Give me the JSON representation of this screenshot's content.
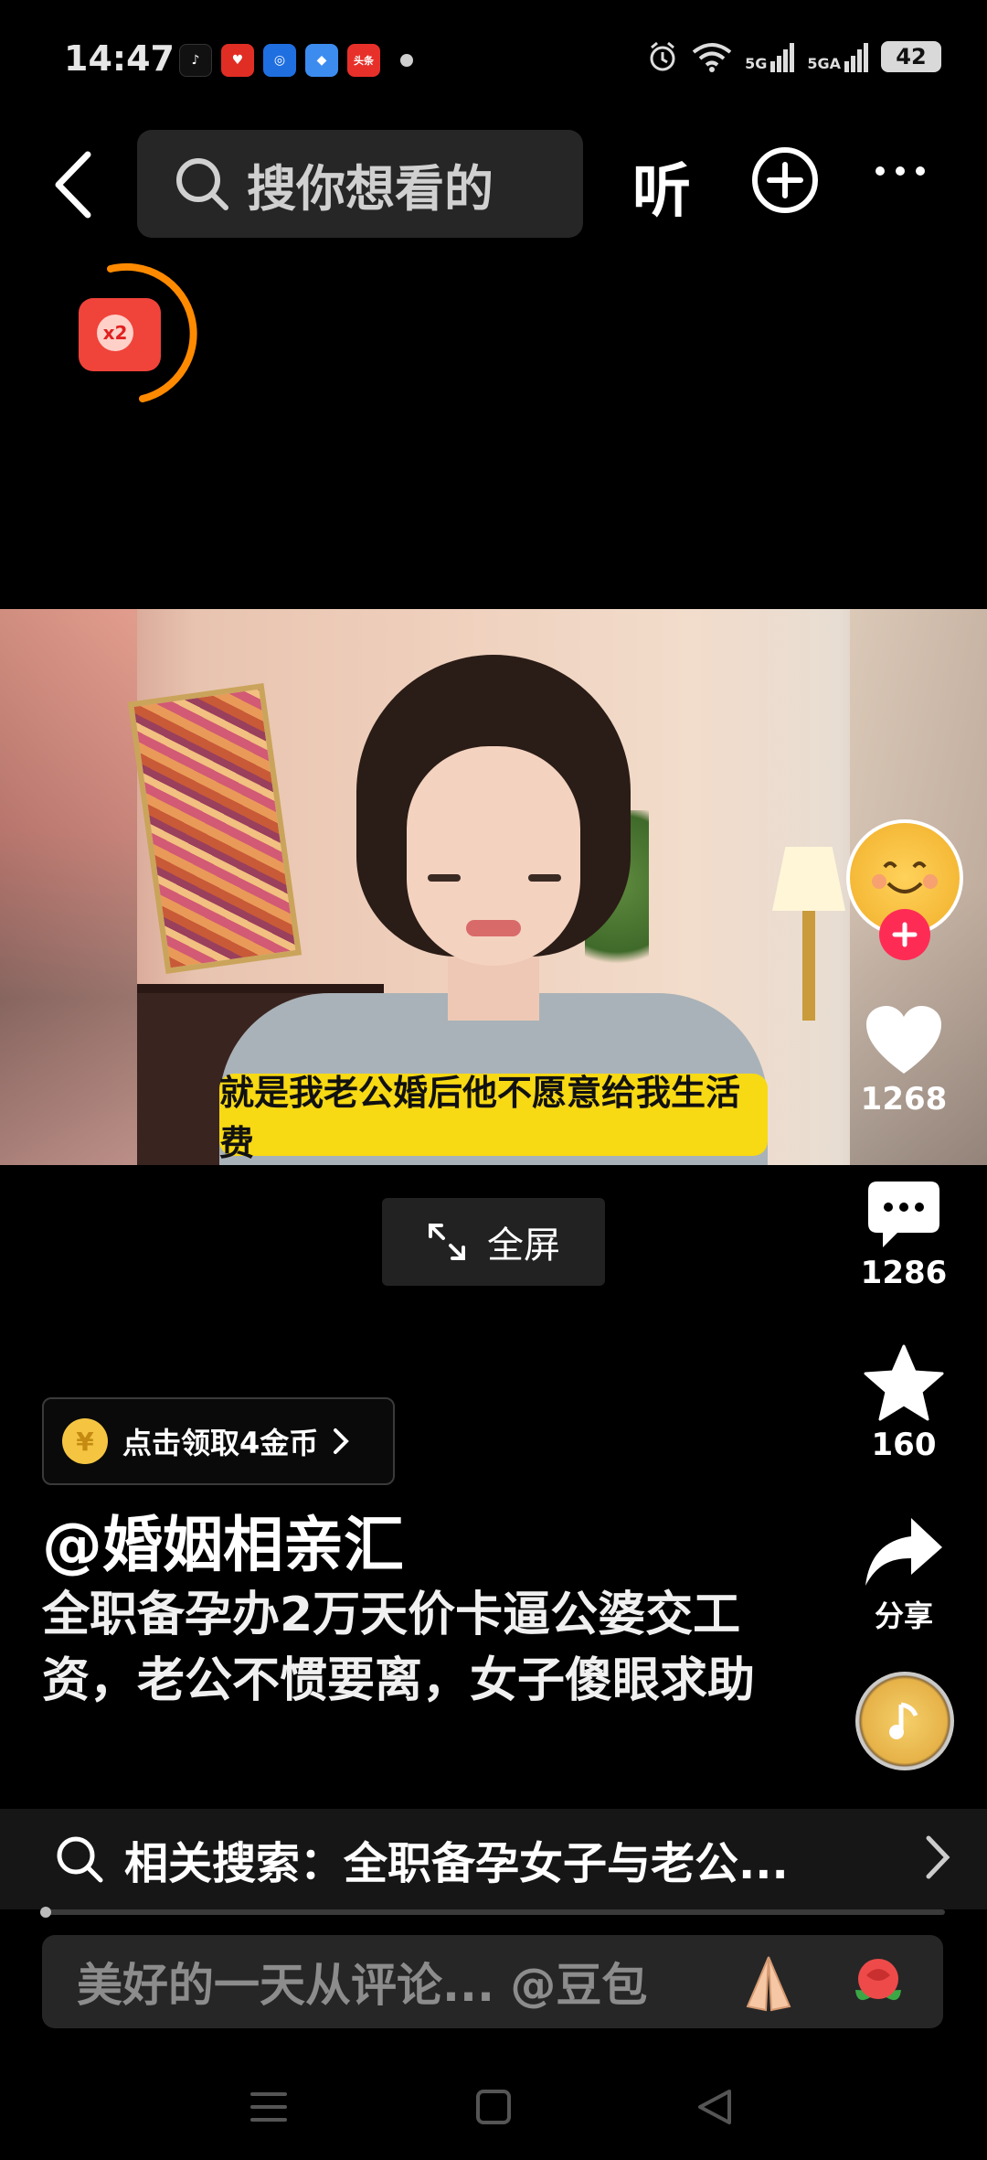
{
  "status_bar": {
    "time": "14:47",
    "notification_icons": [
      {
        "name": "tiktok-icon",
        "color": "#111111",
        "glyph": "♪"
      },
      {
        "name": "pinduoduo-icon",
        "color": "#e02e24",
        "glyph": "♥"
      },
      {
        "name": "app-blue-icon",
        "color": "#1f6fe0",
        "glyph": "◎"
      },
      {
        "name": "app-blue2-icon",
        "color": "#3c8cf0",
        "glyph": "◆"
      },
      {
        "name": "toutiao-icon",
        "color": "#e8302a",
        "glyph": "头条"
      }
    ],
    "sig1": "5G",
    "sig2": "5GA",
    "battery": "42"
  },
  "nav": {
    "search_placeholder": "搜你想看的",
    "listen_label": "听"
  },
  "red_packet": {
    "multiplier": "x2"
  },
  "video": {
    "subtitle": "就是我老公婚后他不愿意给我生活费",
    "fullscreen_label": "全屏"
  },
  "rail": {
    "likes": "1268",
    "comments": "1286",
    "favorites": "160",
    "share_label": "分享"
  },
  "info": {
    "coin_label": "点击领取4金币",
    "author": "@婚姻相亲汇",
    "description": "全职备孕办2万天价卡逼公婆交工资，老公不惯要离，女子傻眼求助"
  },
  "related": {
    "label": "相关搜索：全职备孕女子与老公..."
  },
  "comment": {
    "placeholder": "美好的一天从评论... @豆包"
  },
  "colors": {
    "accent": "#fe2c55",
    "subtitle_bg": "#f7d914",
    "coin": "#f5c542"
  }
}
